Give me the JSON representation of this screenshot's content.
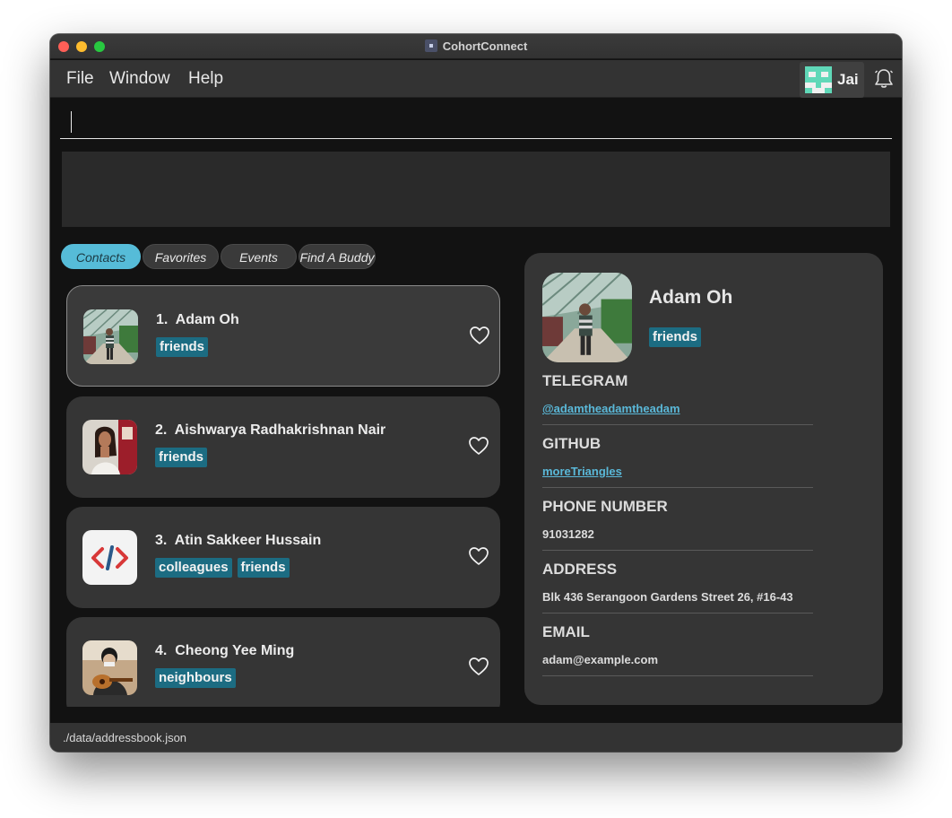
{
  "window": {
    "title": "CohortConnect"
  },
  "menu": {
    "file": "File",
    "window": "Window",
    "help": "Help"
  },
  "user": {
    "name": "Jai"
  },
  "command": {
    "value": "",
    "placeholder": ""
  },
  "result": {
    "text": ""
  },
  "tabs": [
    {
      "label": "Contacts",
      "active": true
    },
    {
      "label": "Favorites",
      "active": false
    },
    {
      "label": "Events",
      "active": false
    },
    {
      "label": "Find A Buddy",
      "active": false
    }
  ],
  "contacts": [
    {
      "index": "1.",
      "name": "Adam Oh",
      "tags": [
        "friends"
      ],
      "avatar": "photo-garden"
    },
    {
      "index": "2.",
      "name": "Aishwarya Radhakrishnan Nair",
      "tags": [
        "friends"
      ],
      "avatar": "photo-woman"
    },
    {
      "index": "3.",
      "name": "Atin Sakkeer Hussain",
      "tags": [
        "colleagues",
        "friends"
      ],
      "avatar": "code-icon"
    },
    {
      "index": "4.",
      "name": "Cheong Yee Ming",
      "tags": [
        "neighbours"
      ],
      "avatar": "photo-guitar"
    }
  ],
  "detail": {
    "name": "Adam Oh",
    "tag": "friends",
    "telegram_label": "TELEGRAM",
    "telegram": "@adamtheadamtheadam",
    "github_label": "GITHUB",
    "github": "moreTriangles",
    "phone_label": "PHONE NUMBER",
    "phone": "91031282",
    "address_label": "ADDRESS",
    "address": "Blk 436 Serangoon Gardens Street 26, #16-43",
    "email_label": "EMAIL",
    "email": "adam@example.com"
  },
  "status": {
    "path": "./data/addressbook.json"
  },
  "colors": {
    "accent": "#56bcd8",
    "tag": "#1c6c82",
    "background": "#121212",
    "card": "#353535"
  },
  "icons": {
    "notifications": "bell-icon",
    "favorite": "heart-outline-icon"
  }
}
